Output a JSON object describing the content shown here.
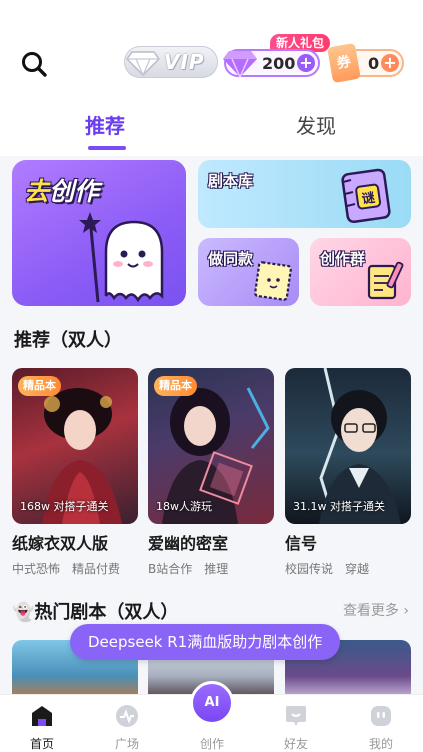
{
  "header": {
    "vip_label": "VIP",
    "gift_tag": "新人礼包",
    "diamonds": "200",
    "coupon_glyph": "券",
    "coupons": "0",
    "plus": "+"
  },
  "tabs": [
    {
      "label": "推荐",
      "active": true
    },
    {
      "label": "发现",
      "active": false
    }
  ],
  "quick_cards": {
    "create": "去创作",
    "library": "剧本库",
    "library_glyph": "谜",
    "same": "做同款",
    "group": "创作群"
  },
  "recommend": {
    "title": "推荐（双人）",
    "stories": [
      {
        "badge": "精品本",
        "plays": "168w 对搭子通关",
        "name": "纸嫁衣双人版",
        "tags": [
          "中式恐怖",
          "精品付费"
        ]
      },
      {
        "badge": "精品本",
        "plays": "18w人游玩",
        "name": "爱幽的密室",
        "tags": [
          "B站合作",
          "推理"
        ]
      },
      {
        "badge": "",
        "plays": "31.1w 对搭子通关",
        "name": "信号",
        "tags": [
          "校园传说",
          "穿越"
        ]
      }
    ]
  },
  "hot": {
    "title": "👻热门剧本（双人）",
    "more": "查看更多 ›"
  },
  "promo": "Deepseek R1满血版助力剧本创作",
  "nav": [
    {
      "label": "首页",
      "icon": "home-icon",
      "active": true
    },
    {
      "label": "广场",
      "icon": "plaza-icon",
      "active": false
    },
    {
      "label": "创作",
      "icon": "create-icon",
      "active": false,
      "bubble": "AI"
    },
    {
      "label": "好友",
      "icon": "friends-icon",
      "active": false
    },
    {
      "label": "我的",
      "icon": "profile-icon",
      "active": false
    }
  ],
  "colors": {
    "accent": "#7b4cf5",
    "background": "#f5f6fa"
  }
}
